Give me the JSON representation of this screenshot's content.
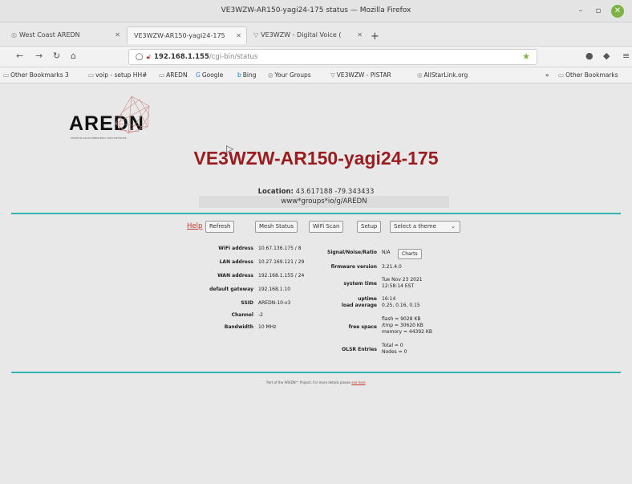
{
  "window": {
    "title": "VE3WZW-AR150-yagi24-175 status — Mozilla Firefox"
  },
  "tabs": [
    {
      "label": "West Coast AREDN",
      "icon": "globe-icon"
    },
    {
      "label": "VE3WZW-AR150-yagi24-175",
      "icon": ""
    },
    {
      "label": "VE3WZW - Digital Voice (",
      "icon": "pistar-icon"
    }
  ],
  "url": {
    "host": "192.168.1.155",
    "path": "/cgi-bin/status"
  },
  "bookmarks": [
    {
      "label": "Other Bookmarks 3"
    },
    {
      "label": "voip - setup HH#"
    },
    {
      "label": "AREDN"
    },
    {
      "label": "Google"
    },
    {
      "label": "Bing"
    },
    {
      "label": "Your Groups"
    },
    {
      "label": "VE3WZW - PISTAR"
    },
    {
      "label": "AllStarLink.org"
    },
    {
      "label": "Other Bookmarks"
    }
  ],
  "logo": {
    "text": "AREDN",
    "subtext": "AMATEUR RADIO EMERGENCY DATA NETWORK"
  },
  "node": {
    "name": "VE3WZW-AR150-yagi24-175",
    "location_label": "Location:",
    "location_value": "43.617188 -79.343433",
    "description": "www*groups*io/g/AREDN"
  },
  "controls": {
    "help": "Help",
    "refresh": "Refresh",
    "mesh_status": "Mesh Status",
    "wifi_scan": "WiFi Scan",
    "setup": "Setup",
    "theme": "Select a theme"
  },
  "left_status": [
    {
      "key": "WiFi address",
      "value": "10.67.136.175 / 8"
    },
    {
      "key": "LAN address",
      "value": "10.27.169.121 / 29"
    },
    {
      "key": "WAN address",
      "value": "192.168.1.155 / 24"
    },
    {
      "key": "default gateway",
      "value": "192.168.1.10"
    },
    {
      "key": "SSID",
      "value": "AREDN-10-v3"
    },
    {
      "key": "Channel",
      "value": "-2"
    },
    {
      "key": "Bandwidth",
      "value": "10 MHz"
    }
  ],
  "right_status": {
    "snr_key": "Signal/Noise/Ratio",
    "snr_value": "N/A",
    "charts": "Charts",
    "firmware_key": "firmware version",
    "firmware_value": "3.21.4.0",
    "time_key": "system time",
    "time_value_1": "Tue Nov 23 2021",
    "time_value_2": "12:58:14 EST",
    "uptime_key": "uptime",
    "uptime_value": "16:14",
    "load_key": "load average",
    "load_value": "0.25, 0.16, 0.15",
    "space_key": "free space",
    "space_value_1": "flash = 9028 KB",
    "space_value_2": "/tmp = 30620 KB",
    "space_value_3": "memory = 44392 KB",
    "olsr_key": "OLSR Entries",
    "olsr_value_1": "Total = 0",
    "olsr_value_2": "Nodes = 0"
  },
  "footer": {
    "text": "Part of the AREDN™ Project. For more details please",
    "link": "see here"
  }
}
